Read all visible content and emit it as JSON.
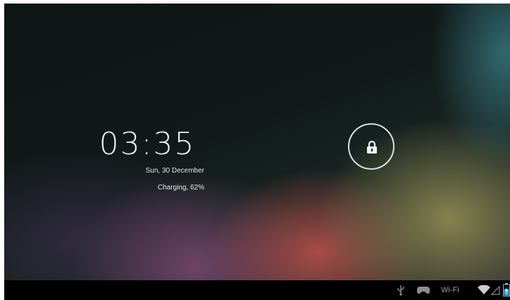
{
  "lockscreen": {
    "time": "03:35",
    "date": "Sun, 30 December",
    "status": "Charging, 62%"
  },
  "status_bar": {
    "wifi_label": "Wi-Fi",
    "battery_percent": 62,
    "icons": [
      "usb-icon",
      "game-controller-icon",
      "wifi-signal-icon",
      "cell-signal-icon",
      "battery-icon"
    ]
  },
  "colors": {
    "background_dark": "#0d1514",
    "text": "#e9eef0",
    "navbar": "#000000"
  }
}
